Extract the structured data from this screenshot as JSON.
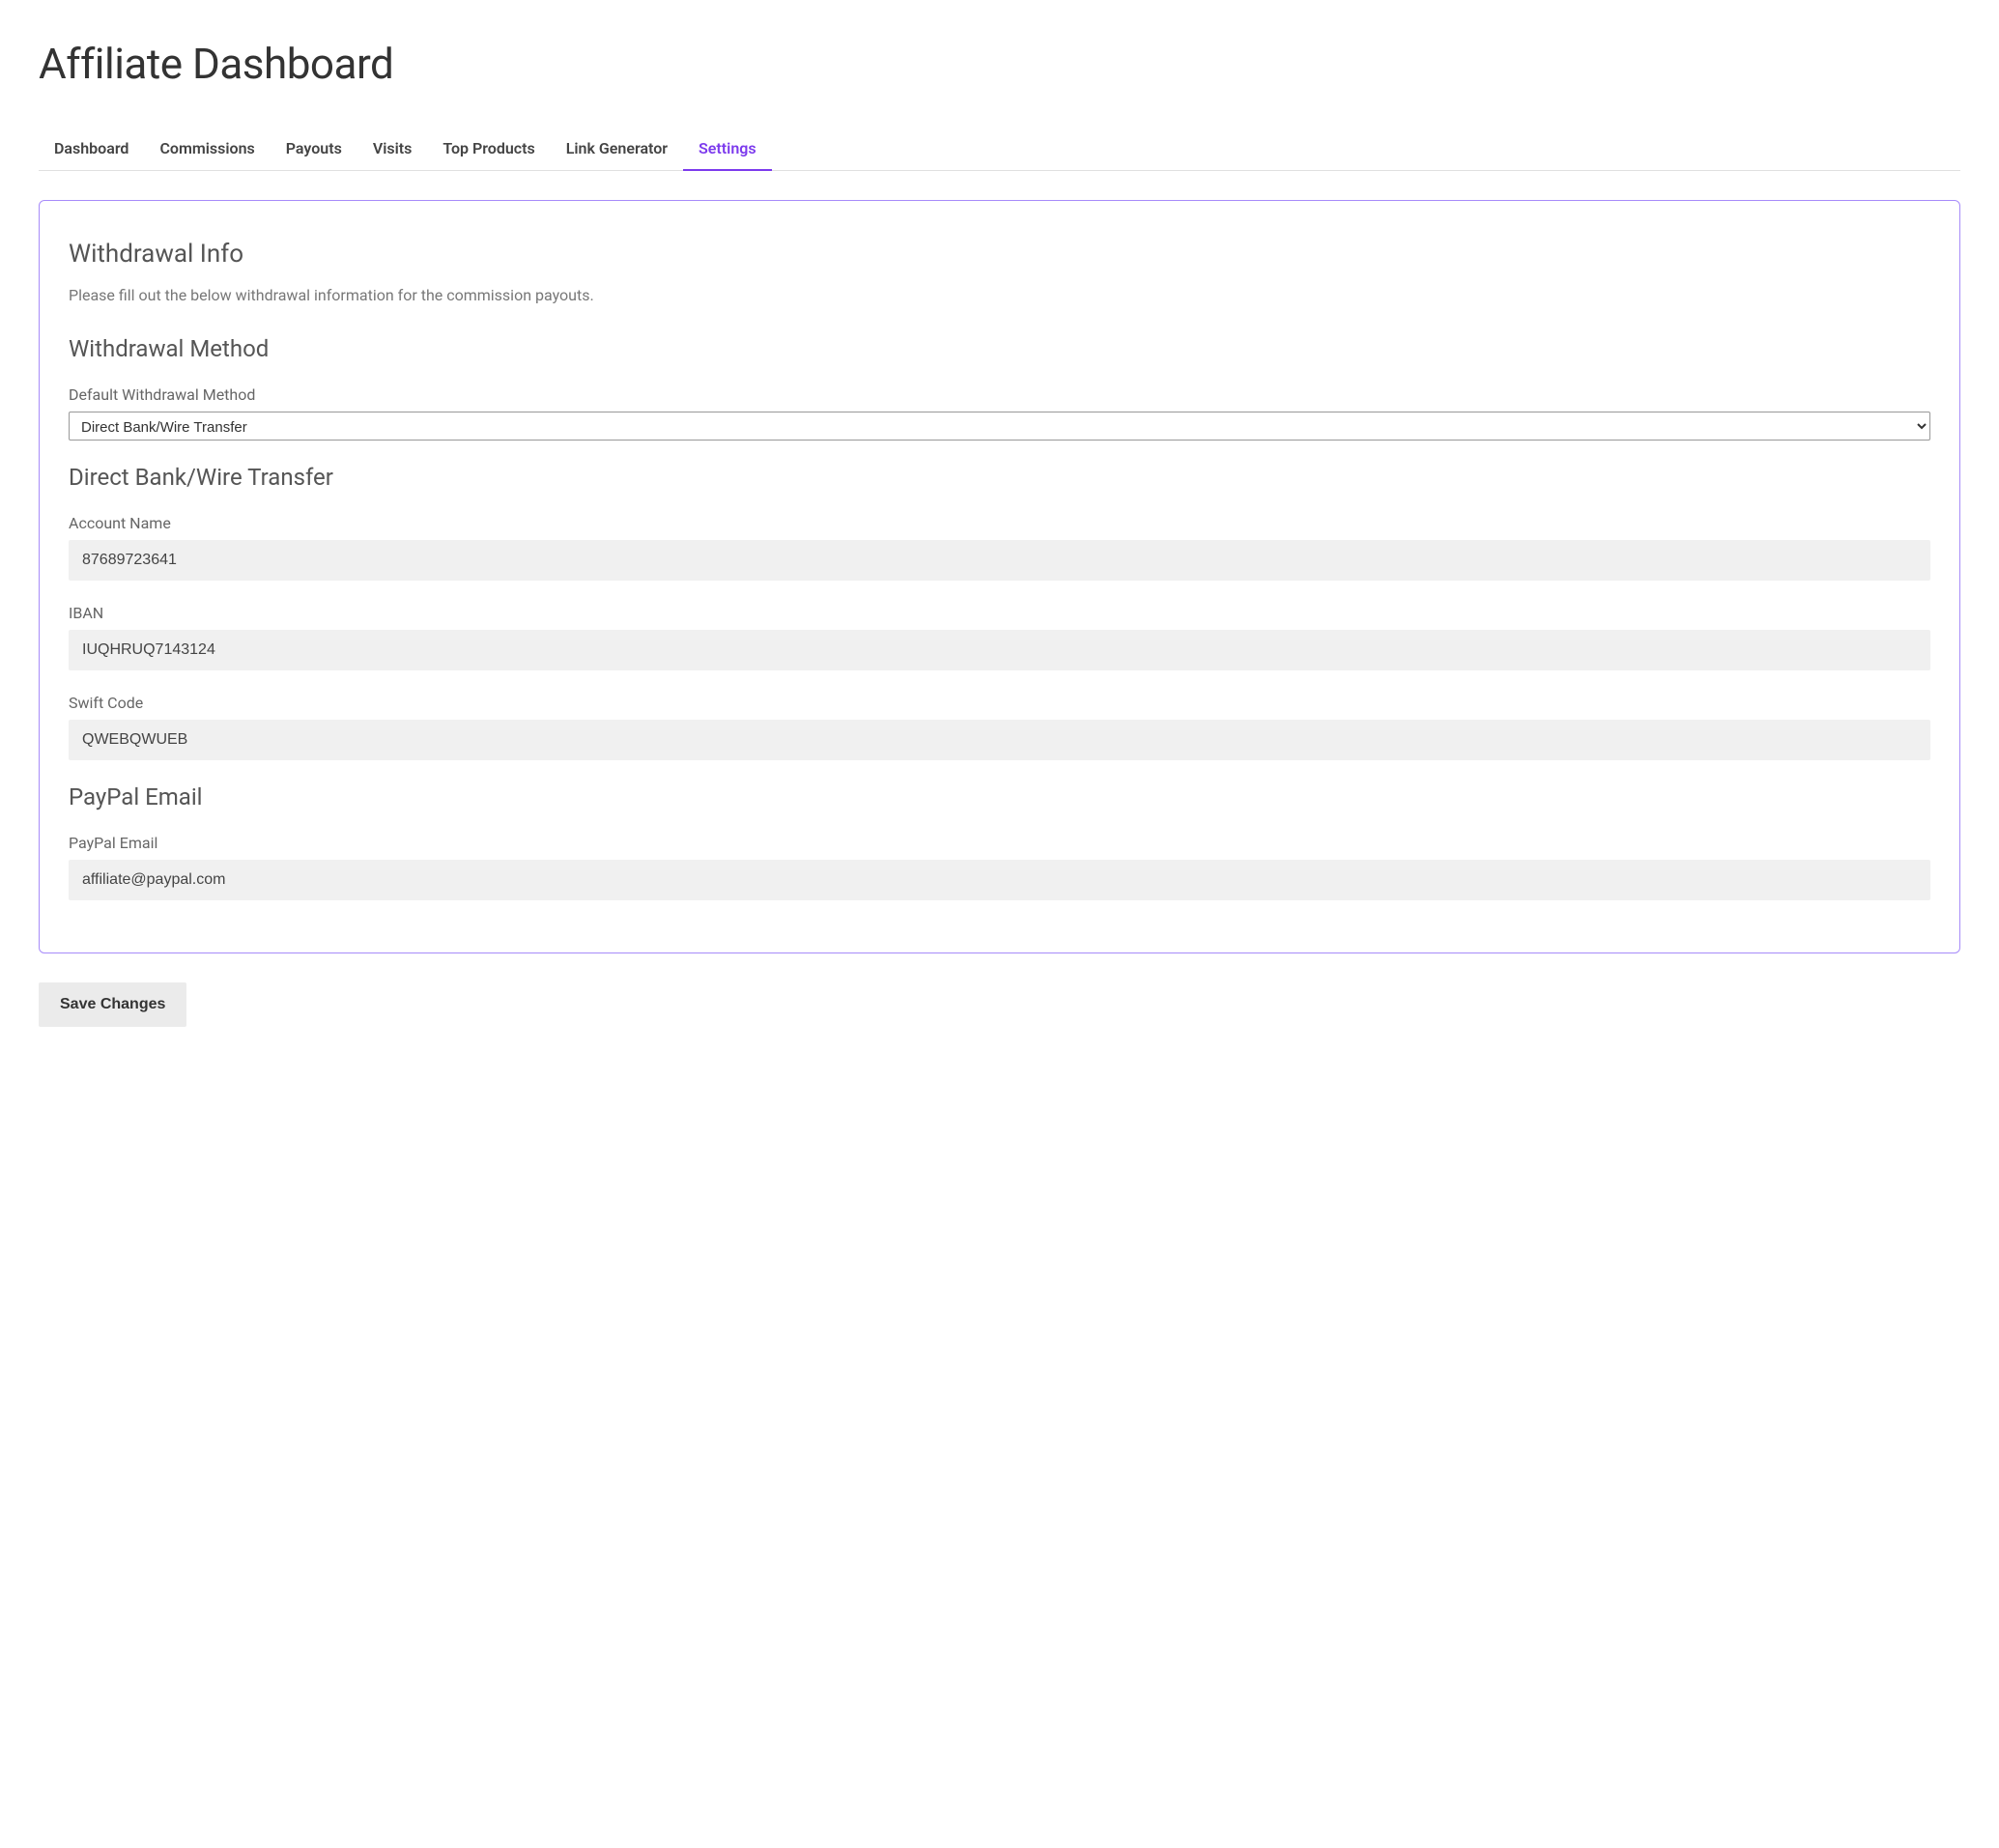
{
  "page": {
    "title": "Affiliate Dashboard"
  },
  "tabs": [
    {
      "label": "Dashboard",
      "active": false
    },
    {
      "label": "Commissions",
      "active": false
    },
    {
      "label": "Payouts",
      "active": false
    },
    {
      "label": "Visits",
      "active": false
    },
    {
      "label": "Top Products",
      "active": false
    },
    {
      "label": "Link Generator",
      "active": false
    },
    {
      "label": "Settings",
      "active": true
    }
  ],
  "withdrawal": {
    "heading": "Withdrawal Info",
    "description": "Please fill out the below withdrawal information for the commission payouts.",
    "method": {
      "heading": "Withdrawal Method",
      "label": "Default Withdrawal Method",
      "value": "Direct Bank/Wire Transfer"
    },
    "bank": {
      "heading": "Direct Bank/Wire Transfer",
      "account_name_label": "Account Name",
      "account_name_value": "87689723641",
      "iban_label": "IBAN",
      "iban_value": "IUQHRUQ7143124",
      "swift_label": "Swift Code",
      "swift_value": "QWEBQWUEB"
    },
    "paypal": {
      "heading": "PayPal Email",
      "label": "PayPal Email",
      "value": "affiliate@paypal.com"
    }
  },
  "actions": {
    "save_label": "Save Changes"
  }
}
